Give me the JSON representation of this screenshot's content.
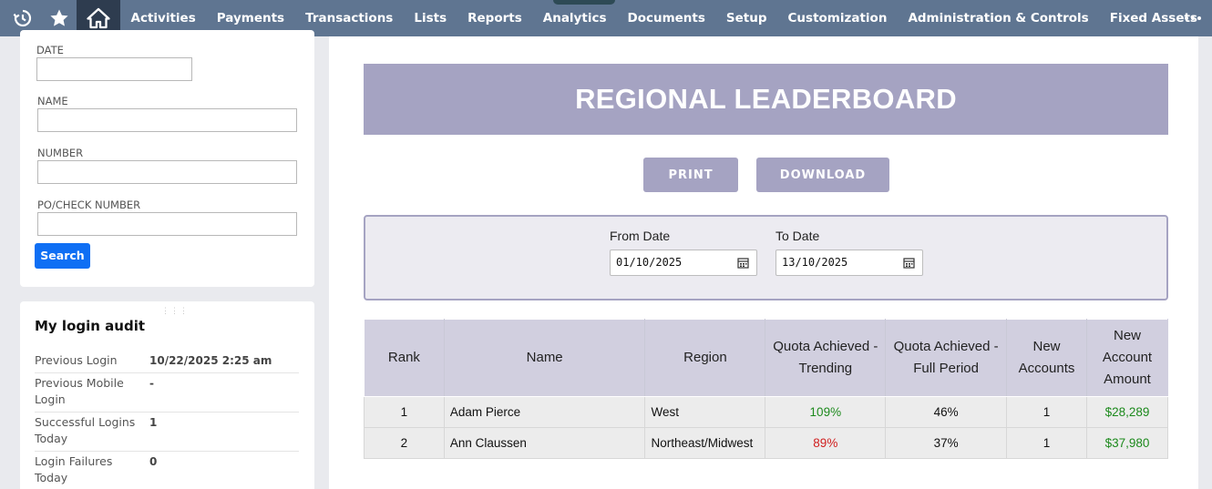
{
  "nav": {
    "items": [
      "Activities",
      "Payments",
      "Transactions",
      "Lists",
      "Reports",
      "Analytics",
      "Documents",
      "Setup",
      "Customization",
      "Administration & Controls",
      "Fixed Assets"
    ]
  },
  "search_form": {
    "date_label": "DATE",
    "name_label": "NAME",
    "number_label": "NUMBER",
    "po_label": "PO/CHECK NUMBER",
    "search_button": "Search"
  },
  "login_audit": {
    "title": "My login audit",
    "rows": [
      {
        "label": "Previous Login",
        "value": "10/22/2025 2:25 am"
      },
      {
        "label": "Previous Mobile Login",
        "value": "-"
      },
      {
        "label": "Successful Logins Today",
        "value": "1"
      },
      {
        "label": "Login Failures Today",
        "value": "0"
      }
    ]
  },
  "leaderboard": {
    "title": "REGIONAL LEADERBOARD",
    "print_button": "PRINT",
    "download_button": "DOWNLOAD",
    "from_date_label": "From Date",
    "from_date_value": "01/10/2025",
    "to_date_label": "To Date",
    "to_date_value": "13/10/2025",
    "columns": [
      "Rank",
      "Name",
      "Region",
      "Quota Achieved - Trending",
      "Quota Achieved - Full Period",
      "New Accounts",
      "New Account Amount"
    ],
    "rows": [
      {
        "rank": "1",
        "name": "Adam Pierce",
        "region": "West",
        "trending": "109%",
        "full": "46%",
        "new_accounts": "1",
        "amount": "$28,289"
      },
      {
        "rank": "2",
        "name": "Ann Claussen",
        "region": "Northeast/Midwest",
        "trending": "89%",
        "full": "37%",
        "new_accounts": "1",
        "amount": "$37,980"
      }
    ]
  },
  "colors": {
    "nav_bg": "#5f7591",
    "accent": "#a5a3c2",
    "positive": "#1d8a1d",
    "negative": "#d02020",
    "search_button": "#0f6ff4"
  }
}
